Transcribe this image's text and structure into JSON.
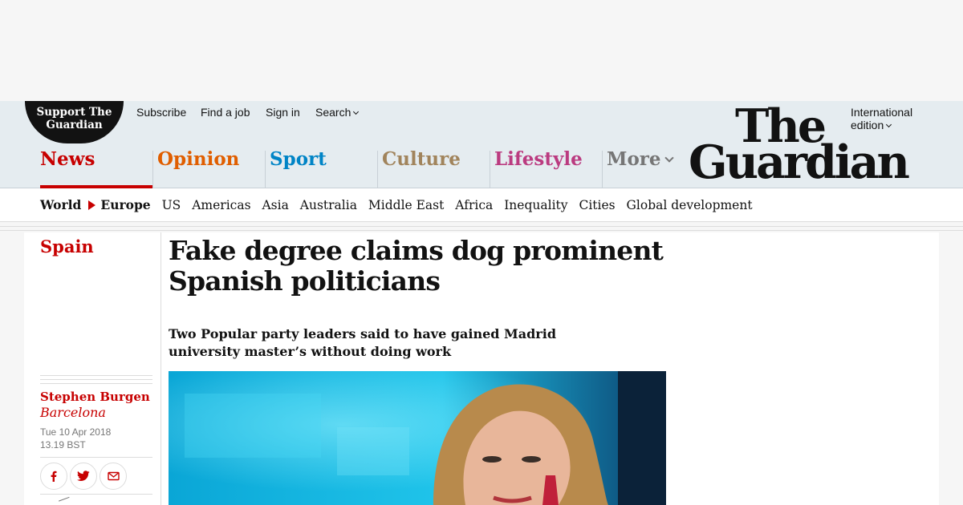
{
  "header": {
    "support_line1": "Support The",
    "support_line2": "Guardian",
    "util_links": {
      "subscribe": "Subscribe",
      "find_job": "Find a job",
      "sign_in": "Sign in",
      "search": "Search"
    },
    "edition_line1": "International",
    "edition_line2": "edition",
    "logo_the": "The",
    "logo_guardian": "Guardian"
  },
  "pillars": {
    "news": "News",
    "opinion": "Opinion",
    "sport": "Sport",
    "culture": "Culture",
    "lifestyle": "Lifestyle",
    "more": "More"
  },
  "subnav": {
    "world": "World",
    "europe": "Europe",
    "us": "US",
    "americas": "Americas",
    "asia": "Asia",
    "australia": "Australia",
    "middle_east": "Middle East",
    "africa": "Africa",
    "inequality": "Inequality",
    "cities": "Cities",
    "global_development": "Global development"
  },
  "article": {
    "section": "Spain",
    "headline": "Fake degree claims dog prominent Spanish politicians",
    "standfirst": "Two Popular party leaders said to have gained Madrid university master’s without doing work",
    "author": "Stephen Burgen",
    "location": "Barcelona",
    "date": "Tue 10 Apr 2018",
    "time": "13.19 BST"
  },
  "icons": {
    "facebook": "facebook-icon",
    "twitter": "twitter-icon",
    "email": "email-icon"
  },
  "colors": {
    "news_red": "#c70000",
    "opinion_orange": "#e05e00",
    "sport_blue": "#0084c6",
    "culture_tan": "#a1845c",
    "lifestyle_pink": "#bb3b80",
    "masthead_bg": "#e5ecf0"
  }
}
